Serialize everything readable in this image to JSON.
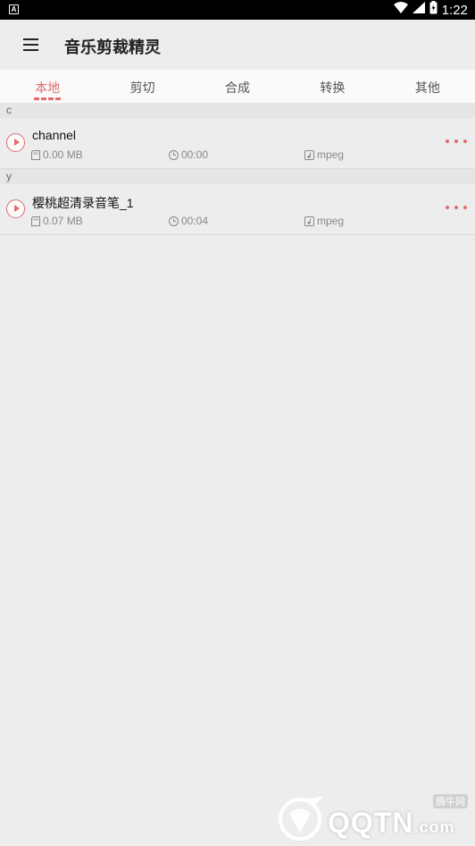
{
  "status_bar": {
    "time": "1:22",
    "notification": "A"
  },
  "app_bar": {
    "title": "音乐剪裁精灵"
  },
  "tabs": [
    {
      "label": "本地",
      "active": true
    },
    {
      "label": "剪切",
      "active": false
    },
    {
      "label": "合成",
      "active": false
    },
    {
      "label": "转换",
      "active": false
    },
    {
      "label": "其他",
      "active": false
    }
  ],
  "sections": [
    {
      "header": "c",
      "items": [
        {
          "name": "channel",
          "size": "0.00 MB",
          "duration": "00:00",
          "format": "mpeg"
        }
      ]
    },
    {
      "header": "y",
      "items": [
        {
          "name": "樱桃超清录音笔_1",
          "size": "0.07 MB",
          "duration": "00:04",
          "format": "mpeg"
        }
      ]
    }
  ],
  "watermark": {
    "text": "QQTN",
    "suffix": ".com",
    "badge": "腾牛网"
  },
  "colors": {
    "accent": "#e06c6c",
    "background": "#ededed",
    "status_bar": "#000000"
  }
}
